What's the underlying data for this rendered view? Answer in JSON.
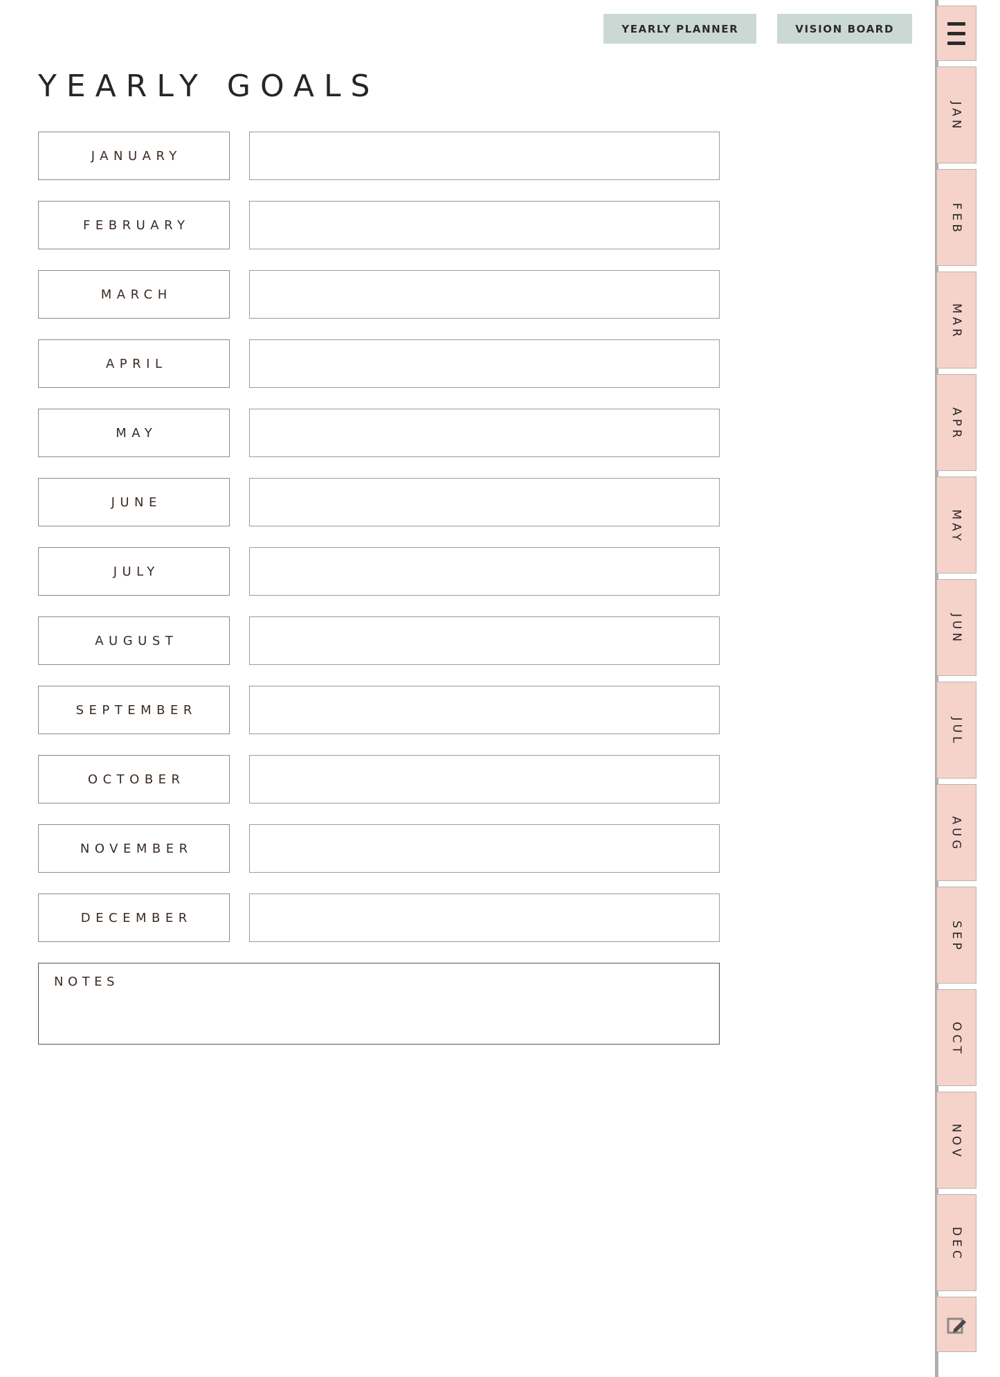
{
  "page": {
    "title": "YEARLY GOALS",
    "background_color": "#FFFFFF"
  },
  "top_tabs": [
    {
      "label": "YEARLY PLANNER",
      "color": "#CBD9D5"
    },
    {
      "label": "VISION BOARD",
      "color": "#CBD9D5"
    }
  ],
  "months": [
    {
      "label": "JANUARY",
      "value": "",
      "placeholder": ""
    },
    {
      "label": "FEBRUARY",
      "value": "",
      "placeholder": ""
    },
    {
      "label": "MARCH",
      "value": "",
      "placeholder": ""
    },
    {
      "label": "APRIL",
      "value": "",
      "placeholder": ""
    },
    {
      "label": "MAY",
      "value": "",
      "placeholder": ""
    },
    {
      "label": "JUNE",
      "value": "",
      "placeholder": ""
    },
    {
      "label": "JULY",
      "value": "",
      "placeholder": ""
    },
    {
      "label": "AUGUST",
      "value": "",
      "placeholder": ""
    },
    {
      "label": "SEPTEMBER",
      "value": "",
      "placeholder": ""
    },
    {
      "label": "OCTOBER",
      "value": "",
      "placeholder": ""
    },
    {
      "label": "NOVEMBER",
      "value": "",
      "placeholder": ""
    },
    {
      "label": "DECEMBER",
      "value": "",
      "placeholder": ""
    }
  ],
  "notes": {
    "label": "NOTES",
    "value": "",
    "placeholder": ""
  },
  "sidebar": {
    "tab_color": "#F5D3CA",
    "spine_color": "#AEAEAE",
    "tabs": [
      {
        "label": "",
        "icon": "hamburger-menu-icon",
        "type": "icon"
      },
      {
        "label": "JAN",
        "icon": "",
        "type": "month"
      },
      {
        "label": "FEB",
        "icon": "",
        "type": "month"
      },
      {
        "label": "MAR",
        "icon": "",
        "type": "month"
      },
      {
        "label": "APR",
        "icon": "",
        "type": "month"
      },
      {
        "label": "MAY",
        "icon": "",
        "type": "month"
      },
      {
        "label": "JUN",
        "icon": "",
        "type": "month"
      },
      {
        "label": "JUL",
        "icon": "",
        "type": "month"
      },
      {
        "label": "AUG",
        "icon": "",
        "type": "month"
      },
      {
        "label": "SEP",
        "icon": "",
        "type": "month"
      },
      {
        "label": "OCT",
        "icon": "",
        "type": "month"
      },
      {
        "label": "NOV",
        "icon": "",
        "type": "month"
      },
      {
        "label": "DEC",
        "icon": "",
        "type": "month"
      },
      {
        "label": "",
        "icon": "pencil-edit-icon",
        "type": "icon"
      }
    ]
  }
}
